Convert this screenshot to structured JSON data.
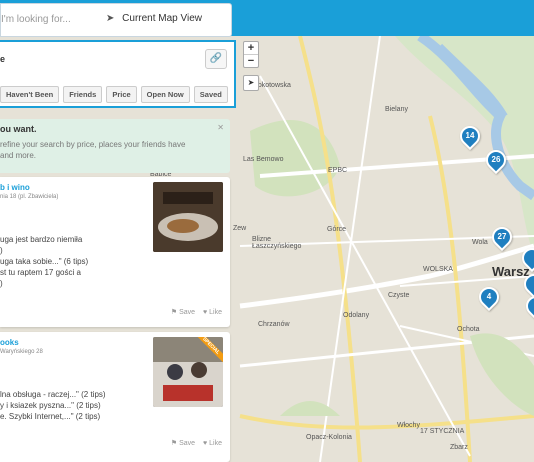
{
  "search": {
    "placeholder": "I'm looking for...",
    "current_map_view": "Current Map View"
  },
  "panel": {
    "label": "e",
    "filters": [
      "Haven't Been",
      "Friends",
      "Price",
      "Open Now",
      "Saved"
    ]
  },
  "tip": {
    "heading": "ou want.",
    "line1": "refine your search by price, places your friends have",
    "line2": "and more."
  },
  "cards": [
    {
      "name": "b i wino",
      "address": "nia 18 (pl. Zbawiciela)",
      "lines": [
        "uga jest bardzo niemiła",
        ")",
        "uga taka sobie...\" (6 tips)",
        "st tu raptem 17 gości a",
        ")"
      ],
      "save": "Save",
      "like": "Like"
    },
    {
      "name": "ooks",
      "address": "Waryńskiego 28",
      "badge": "SPECIAL",
      "lines": [
        "lna obsługa - raczej...\" (2 tips)",
        "y i ksiazek pyszna...\" (2 tips)",
        "e. Szybki Internet,...\" (2 tips)"
      ],
      "save": "Save",
      "like": "Like"
    }
  ],
  "map": {
    "labels": [
      "Mokotowska",
      "Bielany",
      "Las Bemowo",
      "EPBC",
      "Babice",
      "Blizne Łaszczyńskiego",
      "Górce",
      "Chrzanów",
      "Odolany",
      "Wola",
      "Warsz",
      "Ochota",
      "Opacz-Kolonia",
      "Włochy",
      "Zbarz",
      "Zew",
      "WOLSKA",
      "Czyste",
      "17 STYCZNIA"
    ],
    "pins": [
      "14",
      "26",
      "27",
      "4"
    ]
  }
}
